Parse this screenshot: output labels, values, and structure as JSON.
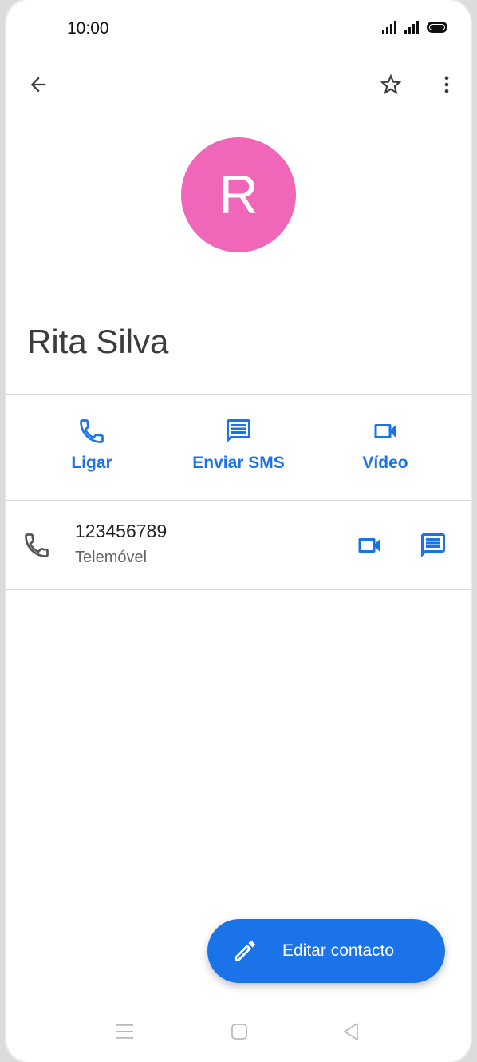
{
  "status": {
    "time": "10:00"
  },
  "contact": {
    "initial": "R",
    "name": "Rita Silva"
  },
  "actions": [
    {
      "label": "Ligar"
    },
    {
      "label": "Enviar SMS"
    },
    {
      "label": "Vídeo"
    }
  ],
  "phone": {
    "number": "123456789",
    "type": "Telemóvel"
  },
  "fab": {
    "label": "Editar contacto"
  },
  "colors": {
    "accent": "#1a73e8",
    "avatar": "#f066b8"
  }
}
